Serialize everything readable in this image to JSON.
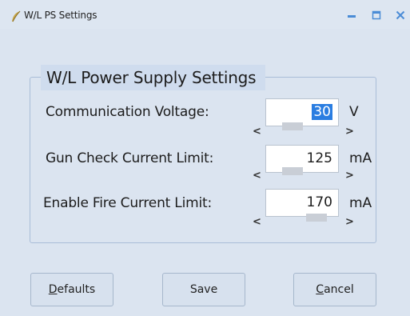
{
  "window": {
    "title": "W/L PS Settings"
  },
  "group": {
    "title": "W/L Power Supply Settings"
  },
  "rows": [
    {
      "label": "Communication Voltage:",
      "value": "30",
      "unit": "V"
    },
    {
      "label": "Gun Check Current Limit:",
      "value": "125",
      "unit": "mA"
    },
    {
      "label": "Enable Fire Current Limit:",
      "value": "170",
      "unit": "mA"
    }
  ],
  "spinner": {
    "left": "<",
    "right": ">"
  },
  "buttons": {
    "defaults": {
      "mnemonic": "D",
      "rest": "efaults"
    },
    "save": "Save",
    "cancel": {
      "mnemonic": "C",
      "rest": "ancel"
    }
  },
  "icons": {
    "app": "feather-icon",
    "minimize": "minimize-icon",
    "maximize": "maximize-icon",
    "close": "close-icon"
  }
}
